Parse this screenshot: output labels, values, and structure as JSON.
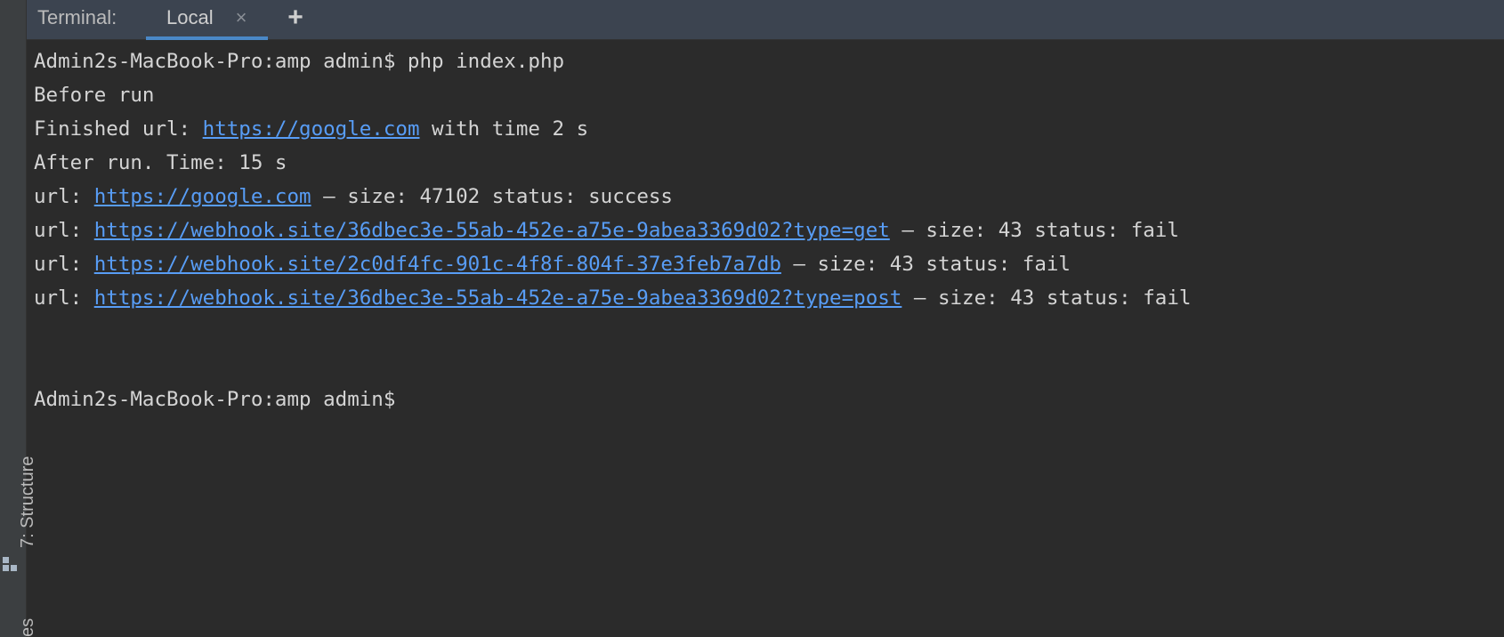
{
  "tabbar": {
    "title": "Terminal:",
    "tab_label": "Local",
    "close_glyph": "×",
    "add_glyph": "+"
  },
  "left_sidebar": {
    "structure_label": "7: Structure",
    "bottom_label": "es"
  },
  "terminal": {
    "prompt_command": "Admin2s-MacBook-Pro:amp admin$ php index.php",
    "before_run": "Before run",
    "finished_prefix": "Finished url: ",
    "finished_url": "https://google.com",
    "finished_suffix": " with time 2 s",
    "after_run": "After run. Time: 15 s",
    "results": [
      {
        "prefix": "url: ",
        "url": "https://google.com",
        "suffix": " – size: 47102 status: success"
      },
      {
        "prefix": "url: ",
        "url": "https://webhook.site/36dbec3e-55ab-452e-a75e-9abea3369d02?type=get",
        "suffix": " – size: 43 status: fail"
      },
      {
        "prefix": "url: ",
        "url": "https://webhook.site/2c0df4fc-901c-4f8f-804f-37e3feb7a7db",
        "suffix": " – size: 43 status: fail"
      },
      {
        "prefix": "url: ",
        "url": "https://webhook.site/36dbec3e-55ab-452e-a75e-9abea3369d02?type=post",
        "suffix": " – size: 43 status: fail"
      }
    ],
    "final_prompt": "Admin2s-MacBook-Pro:amp admin$"
  },
  "colors": {
    "background": "#2b2b2b",
    "tabbar": "#3c4450",
    "link": "#589df6",
    "text": "#d4d4d4",
    "active_tab_underline": "#4a88c7"
  }
}
